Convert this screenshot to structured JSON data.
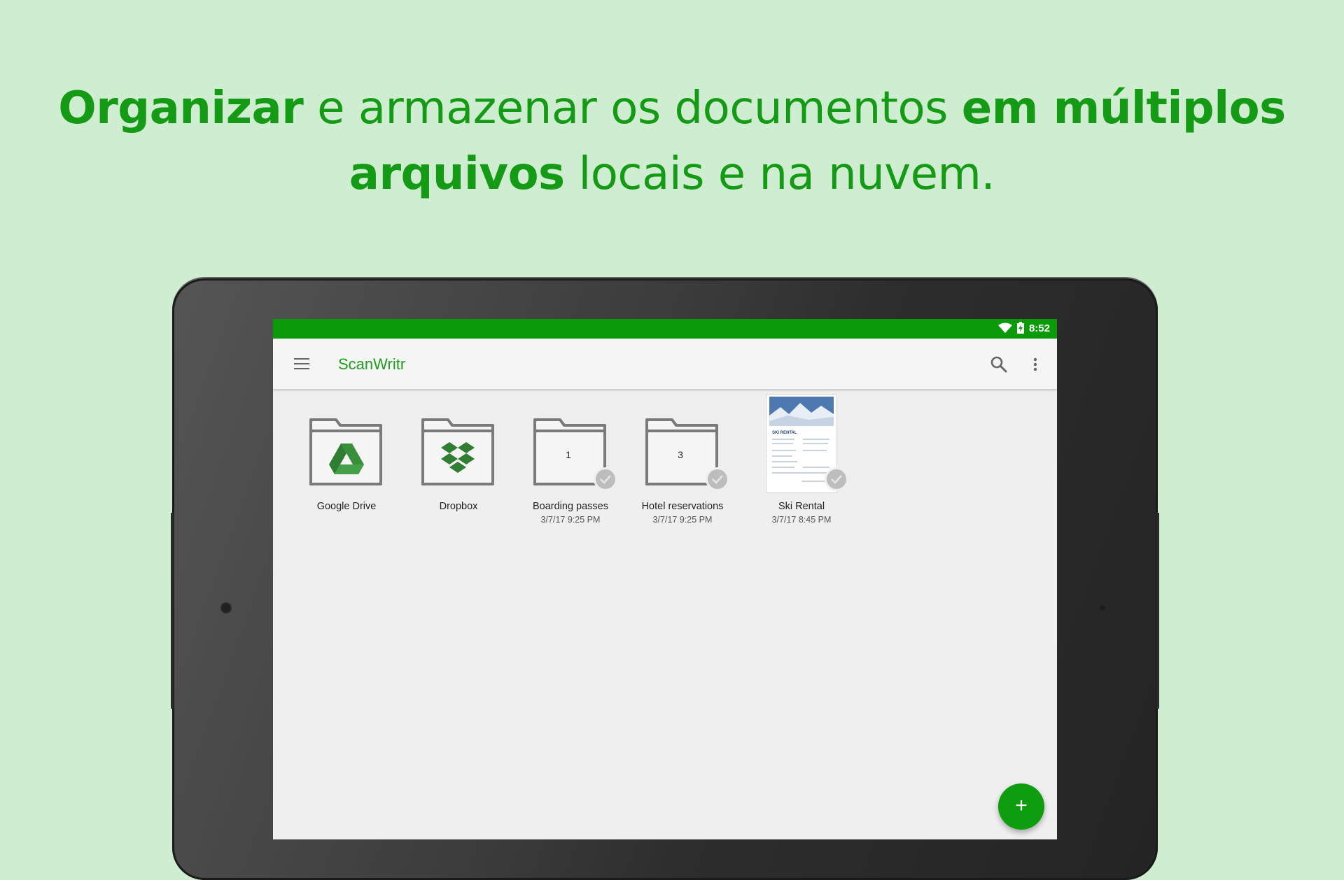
{
  "headline": {
    "line1": [
      {
        "text": "Organizar",
        "bold": true
      },
      {
        "text": " e armazenar os documentos ",
        "bold": false
      },
      {
        "text": "em múltiplos",
        "bold": true
      }
    ],
    "line2": [
      {
        "text": "arquivos",
        "bold": true
      },
      {
        "text": " locais e na nuvem.",
        "bold": false
      }
    ]
  },
  "status": {
    "time": "8:52",
    "icons": [
      "wifi-icon",
      "battery-charging-icon"
    ]
  },
  "appbar": {
    "title": "ScanWritr",
    "icons": [
      "menu-icon",
      "search-icon",
      "more-vert-icon"
    ]
  },
  "items": [
    {
      "name": "Google Drive",
      "date": "",
      "type": "google-drive-folder"
    },
    {
      "name": "Dropbox",
      "date": "",
      "type": "dropbox-folder"
    },
    {
      "name": "Boarding passes",
      "date": "3/7/17 9:25 PM",
      "type": "folder",
      "count": "1"
    },
    {
      "name": "Hotel reservations",
      "date": "3/7/17 9:25 PM",
      "type": "folder",
      "count": "3"
    },
    {
      "name": "Ski Rental",
      "date": "3/7/17 8:45 PM",
      "type": "document",
      "thumb_title": "SKI RENTAL"
    }
  ],
  "fab": {
    "label": "+"
  },
  "colors": {
    "brand_green": "#0a9a0a",
    "headline_green": "#149a14",
    "background": "#cfedd0"
  }
}
